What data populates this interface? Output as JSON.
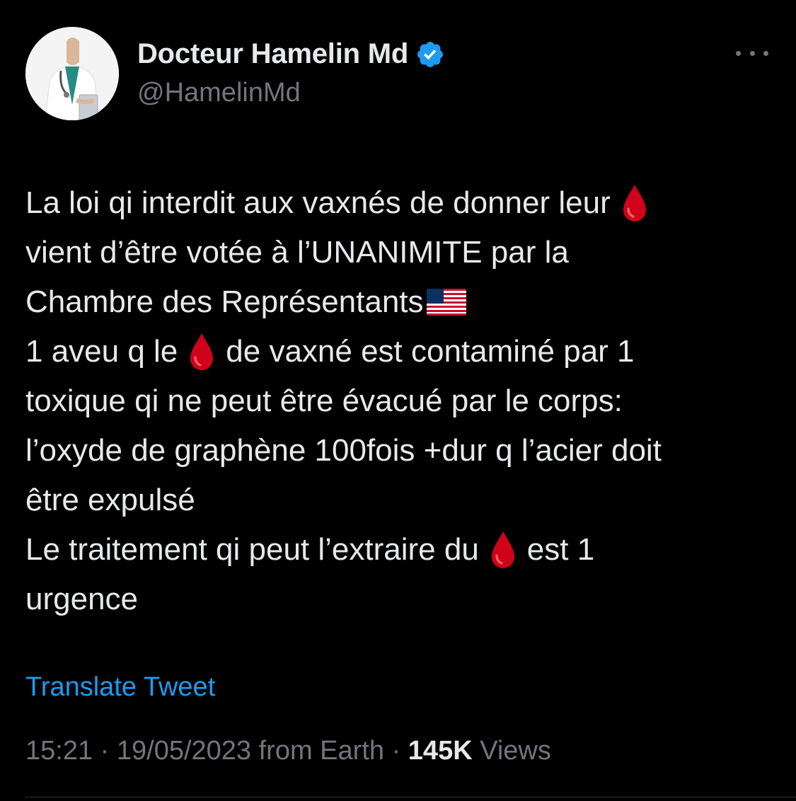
{
  "author": {
    "display_name": "Docteur Hamelin Md",
    "handle": "@HamelinMd",
    "verified_icon": "verified-badge-icon",
    "verified_color": "#1d9bf0"
  },
  "tweet": {
    "lines": [
      {
        "a": "La loi qi interdit aux vaxnés de donner leur",
        "b": ""
      },
      {
        "a": "vient d’être votée à l’UNANIMITE par la",
        "b": ""
      },
      {
        "a": "Chambre des Représentants",
        "b": ""
      },
      {
        "a": "1 aveu q le",
        "b": "de vaxné est contaminé par 1"
      },
      {
        "a": "toxique qi ne peut être évacué par le corps:",
        "b": ""
      },
      {
        "a": "l’oxyde de graphène 100fois +dur q l’acier doit",
        "b": ""
      },
      {
        "a": "être expulsé",
        "b": ""
      },
      {
        "a": "Le traitement qi peut l’extraire du",
        "b": "est 1"
      },
      {
        "a": "urgence",
        "b": ""
      }
    ],
    "emoji": {
      "blood_drop": "blood-drop-icon",
      "flag": "us-flag-icon"
    }
  },
  "translate_label": "Translate Tweet",
  "meta": {
    "time": "15:21",
    "sep1": " · ",
    "date": "19/05/2023",
    "source": " from Earth",
    "sep2": " · ",
    "views_count": "145K",
    "views_label": " Views"
  },
  "colors": {
    "background": "#000000",
    "text": "#e7e9ea",
    "secondary": "#71767b",
    "link": "#1d9bf0",
    "drop": "#d0021b"
  }
}
